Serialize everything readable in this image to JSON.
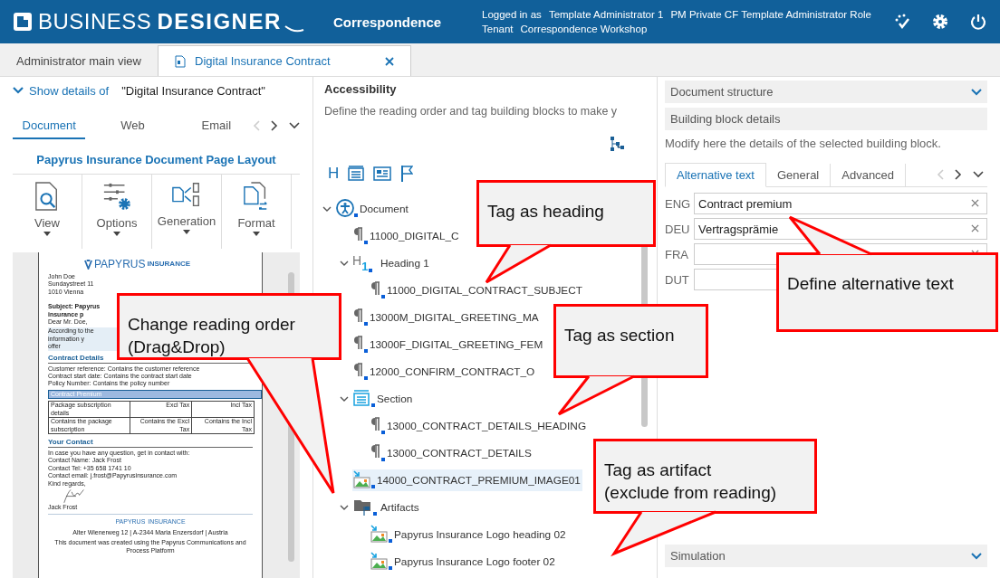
{
  "header": {
    "brand_light": "BUSINESS",
    "brand_bold": "DESIGNER",
    "module": "Correspondence",
    "login_label": "Logged in as",
    "user": "Template Administrator 1",
    "role": "PM Private CF Template Administrator Role",
    "tenant_label": "Tenant",
    "tenant": "Correspondence Workshop"
  },
  "tabs": [
    {
      "label": "Administrator main view",
      "selected": false,
      "icon": false,
      "closable": false
    },
    {
      "label": "Digital Insurance Contract",
      "selected": true,
      "icon": true,
      "closable": true
    }
  ],
  "left": {
    "details_label": "Show details of",
    "details_value": "\"Digital Insurance Contract\"",
    "tabs": [
      {
        "label": "Document",
        "selected": true
      },
      {
        "label": "Web",
        "selected": false
      },
      {
        "label": "Email",
        "selected": false
      }
    ],
    "layout_title": "Papyrus Insurance Document Page Layout",
    "tools": [
      {
        "label": "View",
        "kind": "view"
      },
      {
        "label": "Options",
        "kind": "options"
      },
      {
        "label": "Generation",
        "kind": "generation"
      },
      {
        "label": "Format",
        "kind": "format"
      }
    ],
    "preview": {
      "logo": "PAPYRUS",
      "logo_suffix": "INSURANCE",
      "address": [
        "John Doe",
        "Sundaystreet 11",
        "1010 Vienna"
      ],
      "subject": "Subject: Papyrus insurance p",
      "salutation": "Dear Mr. Doe,",
      "intro": [
        "According to the information y",
        "offer"
      ],
      "details_heading": "Contract Details",
      "details_lines": [
        "Customer reference: Contains the customer reference",
        "Contract start date: Contains the contract start date",
        "Policy Number: Contains the policy number"
      ],
      "premium_heading": "Contract Premium",
      "table": [
        [
          "Package subscription details",
          "Excl Tax",
          "Incl Tax"
        ],
        [
          "Contains the package subscription",
          "Contains the Excl Tax",
          "Contains the Incl Tax"
        ]
      ],
      "contact_heading": "Your Contact",
      "contact_lines": [
        "In case you have any question, get in contact with:",
        "Contact Name: Jack Frost",
        "Contact Tel: +35 658 1741 10",
        "Contact email: j.frost@Papyrusinsurance.com",
        "Kind regards,"
      ],
      "signer": "Jack Frost",
      "footer_logo": "PAPYRUS",
      "footer_logo_suffix": "INSURANCE",
      "footer_address": "Alter Wienerweg 12 | A-2344 Maria Enzersdorf | Austria",
      "footer_note": "This document was created using the Papyrus Communications and Process Platform"
    }
  },
  "middle": {
    "title": "Accessibility",
    "description": "Define the reading order and tag building blocks to make y",
    "tag_tools": [
      {
        "kind": "heading",
        "glyph": "H"
      },
      {
        "kind": "section"
      },
      {
        "kind": "paragraph"
      },
      {
        "kind": "artifact"
      }
    ],
    "tree": [
      {
        "label": "Document",
        "kind": "document",
        "expanded": true,
        "selected": false,
        "children": [
          {
            "label": "11000_DIGITAL_C",
            "kind": "paragraph",
            "selected": false
          },
          {
            "label": "Heading 1",
            "kind": "heading",
            "glyph": "H",
            "heading_number": "1",
            "expanded": true,
            "selected": false,
            "children": [
              {
                "label": "11000_DIGITAL_CONTRACT_SUBJECT",
                "kind": "paragraph",
                "selected": false
              }
            ]
          },
          {
            "label": "13000M_DIGITAL_GREETING_MA",
            "kind": "paragraph",
            "selected": false
          },
          {
            "label": "13000F_DIGITAL_GREETING_FEM",
            "kind": "paragraph",
            "selected": false
          },
          {
            "label": "12000_CONFIRM_CONTRACT_O",
            "kind": "paragraph",
            "selected": false
          },
          {
            "label": "Section",
            "kind": "section",
            "expanded": true,
            "selected": false,
            "children": [
              {
                "label": "13000_CONTRACT_DETAILS_HEADING",
                "kind": "paragraph",
                "selected": false
              },
              {
                "label": "13000_CONTRACT_DETAILS",
                "kind": "paragraph",
                "selected": false
              }
            ]
          },
          {
            "label": "14000_CONTRACT_PREMIUM_IMAGE01",
            "kind": "image",
            "selected": true
          },
          {
            "label": "Artifacts",
            "kind": "artifacts",
            "expanded": true,
            "selected": false,
            "children": [
              {
                "label": "Papyrus Insurance Logo heading 02",
                "kind": "image",
                "selected": false
              },
              {
                "label": "Papyrus Insurance Logo footer 02",
                "kind": "image",
                "selected": false
              }
            ]
          }
        ]
      }
    ]
  },
  "right": {
    "structure_title": "Document structure",
    "details_title": "Building block details",
    "details_description": "Modify here the details of the selected building block.",
    "tabs": [
      {
        "label": "Alternative text",
        "selected": true
      },
      {
        "label": "General",
        "selected": false
      },
      {
        "label": "Advanced",
        "selected": false
      }
    ],
    "alt_texts": [
      {
        "lang": "ENG",
        "value": "Contract premium",
        "clearable": true
      },
      {
        "lang": "DEU",
        "value": "Vertragsprämie",
        "clearable": true
      },
      {
        "lang": "FRA",
        "clearable": true
      },
      {
        "lang": "DUT"
      }
    ],
    "simulation_title": "Simulation"
  },
  "callouts": [
    {
      "text": "Tag as heading"
    },
    {
      "text": "Change reading order\n(Drag&Drop)"
    },
    {
      "text": "Tag as section"
    },
    {
      "text": "Define alternative text"
    },
    {
      "text": "Tag as artifact\n(exclude from reading)"
    }
  ]
}
